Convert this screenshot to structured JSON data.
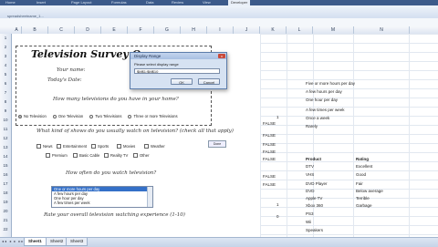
{
  "window": {
    "doc_title": "spreadsheetname_1...",
    "ribbon_tabs": [
      "Home",
      "Insert",
      "Page Layout",
      "Formulas",
      "Data",
      "Review",
      "View",
      "Developer"
    ],
    "active_tab": "Developer"
  },
  "columns": [
    "A",
    "B",
    "C",
    "D",
    "E",
    "F",
    "G",
    "H",
    "I",
    "J",
    "K",
    "L",
    "M",
    "N"
  ],
  "rows": [
    "1",
    "2",
    "3",
    "4",
    "5",
    "6",
    "7",
    "8",
    "9",
    "10",
    "11",
    "12",
    "13",
    "14",
    "15",
    "16",
    "17",
    "18",
    "19",
    "20",
    "21",
    "22",
    "23",
    "24"
  ],
  "survey": {
    "title": "Television Survey Q",
    "your_name": "Your name:",
    "todays_date": "Today's Date:",
    "q_how_many": "How many televisions do you have in your home?",
    "radio_options": [
      "No Television",
      "One Television",
      "Two Televisions",
      "Three or more Televisions"
    ],
    "q_what_kind": "What kind of shows do you usually watch on television? (check all that apply)",
    "checkboxes": [
      "News",
      "Entertainment",
      "Sports",
      "Movies",
      "Weather",
      "Premium",
      "Basic Cable",
      "Reality TV",
      "Other"
    ],
    "q_how_often": "How often do you watch television?",
    "list_items": [
      "One or more hours per day",
      "A few hours per day",
      "One hour per day",
      "A few times per week"
    ],
    "q_rate": "Rate your overall television watching experience (1-10)",
    "mini_button": "Done"
  },
  "dialog": {
    "title": "Display Range",
    "prompt": "Please select display range",
    "input_value": "$M$1:$M$10",
    "ok": "OK",
    "cancel": "Cancel",
    "close": "x"
  },
  "right_cells": {
    "falses": [
      "FALSE",
      "FALSE",
      "FALSE",
      "FALSE",
      "FALSE",
      "FALSE",
      "FALSE"
    ],
    "num_1": "1",
    "num_0": "0",
    "num_1b": "1",
    "list_m": [
      "Five or more hours per day",
      "A few hours per day",
      "One hour per day",
      "A few times per week",
      "Once a week",
      "Rarely"
    ],
    "product_header": "Product",
    "rating_header": "Rating",
    "products": [
      "DTV",
      "VHS",
      "DVD Player",
      "DVD",
      "Apple TV",
      "Xbox 360",
      "PS3",
      "Wii",
      "Speakers"
    ],
    "ratings": [
      "Excellent",
      "Good",
      "Fair",
      "Below average",
      "Terrible",
      "Garbage"
    ]
  },
  "sheets": [
    "Sheet1",
    "Sheet2",
    "Sheet3"
  ],
  "active_sheet": "Sheet1"
}
